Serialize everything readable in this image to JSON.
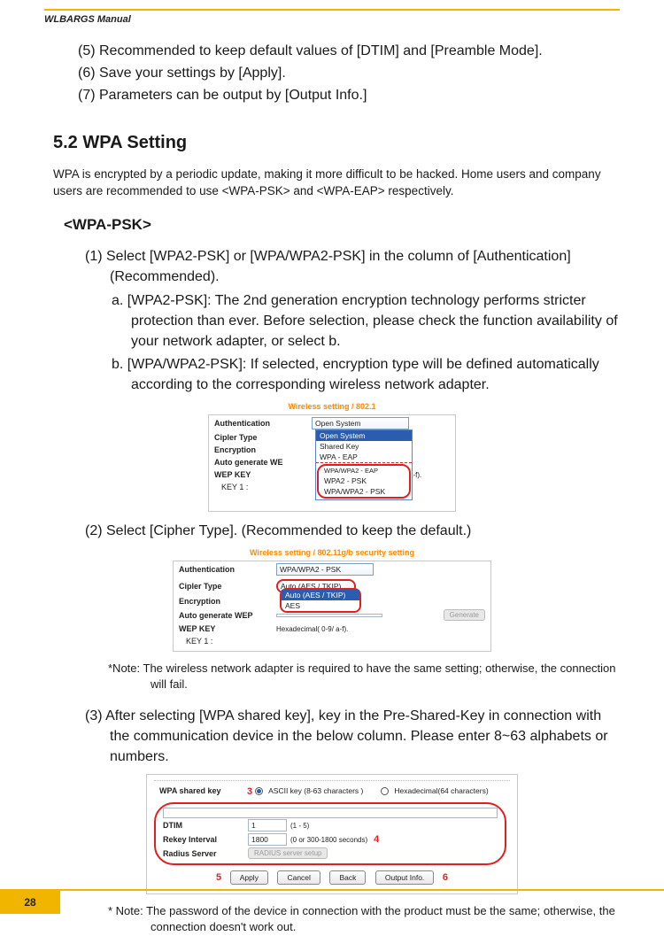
{
  "header": {
    "title": "WLBARGS Manual"
  },
  "top_list": {
    "i5": "(5) Recommended to keep default values of [DTIM] and [Preamble Mode].",
    "i6": "(6) Save your settings by [Apply].",
    "i7": "(7) Parameters can be output by [Output Info.]"
  },
  "section": {
    "heading": "5.2 WPA Setting",
    "intro": "WPA is encrypted by a periodic update, making it more difficult to be hacked. Home users and company users are recommended to use <WPA-PSK> and <WPA-EAP> respectively.",
    "sub_heading": "<WPA-PSK>",
    "step1": "(1) Select [WPA2-PSK] or [WPA/WPA2-PSK] in the column of [Authentication] (Recommended).",
    "step1a": "a. [WPA2-PSK]: The 2nd generation encryption technology performs stricter protection than ever.  Before selection, please check the function availability of your network adapter, or select b.",
    "step1b": "b. [WPA/WPA2-PSK]: If selected, encryption type will be defined automatically according to the corresponding wireless network adapter.",
    "step2": "(2) Select [Cipher Type]. (Recommended to keep the default.)",
    "note1": "*Note: The wireless network adapter is required to have the same setting; otherwise, the connection will fail.",
    "step3": "(3) After selecting [WPA shared key], key in the Pre-Shared-Key in connection with the communication device in the below column.  Please enter 8~63 alphabets or numbers.",
    "note2": "* Note: The password of the device in connection with the product must be the same; otherwise, the connection doesn't work out."
  },
  "fig1": {
    "title": "Wireless setting / 802.1",
    "labels": {
      "auth": "Authentication",
      "cipher": "Cipler Type",
      "enc": "Encryption",
      "autogen": "Auto generate WE",
      "wep": "WEP KEY",
      "key1": "KEY 1 :"
    },
    "dropdown": {
      "selected": "Open System",
      "opts": [
        "Open System",
        "Shared Key",
        "WPA - EAP",
        "WPA/WPA2 - EAP",
        "WPA2 - PSK",
        "WPA/WPA2 - PSK"
      ]
    },
    "suffix": "a-f)."
  },
  "fig2": {
    "title": "Wireless setting / 802.11g/b security setting",
    "labels": {
      "auth": "Authentication",
      "cipher": "Cipler Type",
      "enc": "Encryption",
      "autogen": "Auto generate WEP",
      "wep": "WEP KEY",
      "key1": "KEY 1 :"
    },
    "auth_val": "WPA/WPA2 - PSK",
    "cipher_sel": "Auto (AES / TKIP)",
    "opts": [
      "Auto (AES / TKIP)",
      "AES"
    ],
    "wep_hint": "Hexadecimal( 0-9/  a-f).",
    "gen_btn": "Generate"
  },
  "fig3": {
    "labels": {
      "shared": "WPA shared key",
      "dtim": "DTIM",
      "rekey": "Rekey Interval",
      "radius": "Radius Server"
    },
    "radio1": "ASCII key (8-63 characters )",
    "radio2": "Hexadecimal(64 characters)",
    "dtim_val": "1",
    "dtim_hint": "(1 - 5)",
    "rekey_val": "1800",
    "rekey_hint": "(0 or 300-1800 seconds)",
    "radius_btn": "RADIUS server setup",
    "btns": {
      "apply": "Apply",
      "cancel": "Cancel",
      "back": "Back",
      "output": "Output Info."
    },
    "num3": "3",
    "num4": "4",
    "num5": "5",
    "num6": "6"
  },
  "page_number": "28"
}
